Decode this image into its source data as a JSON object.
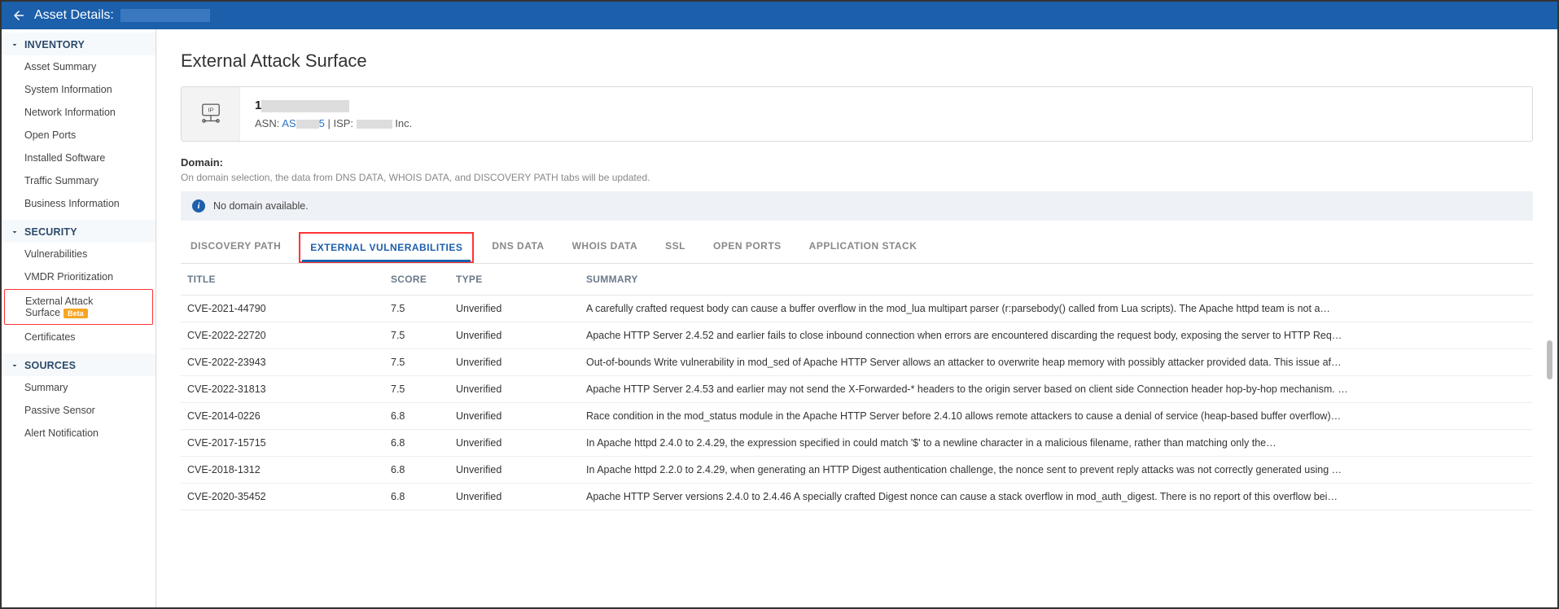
{
  "header": {
    "title_prefix": "Asset Details:"
  },
  "sidebar": {
    "sections": [
      {
        "label": "INVENTORY",
        "items": [
          {
            "label": "Asset Summary",
            "name": "asset-summary"
          },
          {
            "label": "System Information",
            "name": "system-information"
          },
          {
            "label": "Network Information",
            "name": "network-information"
          },
          {
            "label": "Open Ports",
            "name": "open-ports"
          },
          {
            "label": "Installed Software",
            "name": "installed-software"
          },
          {
            "label": "Traffic Summary",
            "name": "traffic-summary"
          },
          {
            "label": "Business Information",
            "name": "business-information"
          }
        ]
      },
      {
        "label": "SECURITY",
        "items": [
          {
            "label": "Vulnerabilities",
            "name": "vulnerabilities"
          },
          {
            "label": "VMDR Prioritization",
            "name": "vmdr-prioritization"
          },
          {
            "label": "External Attack Surface",
            "name": "external-attack-surface",
            "badge": "Beta",
            "active": true
          },
          {
            "label": "Certificates",
            "name": "certificates"
          }
        ]
      },
      {
        "label": "SOURCES",
        "items": [
          {
            "label": "Summary",
            "name": "sources-summary"
          },
          {
            "label": "Passive Sensor",
            "name": "passive-sensor"
          },
          {
            "label": "Alert Notification",
            "name": "alert-notification"
          }
        ]
      }
    ]
  },
  "main": {
    "page_title": "External Attack Surface",
    "info": {
      "ip_prefix": "1",
      "asn_label": "ASN:",
      "asn_prefix": "AS",
      "asn_suffix": "5",
      "isp_label": "ISP:",
      "isp_suffix": "Inc.",
      "sep": "  |  "
    },
    "domain": {
      "label": "Domain:",
      "desc": "On domain selection, the data from DNS DATA, WHOIS DATA, and DISCOVERY PATH tabs will be updated.",
      "alert": "No domain available."
    },
    "tabs": [
      {
        "label": "DISCOVERY PATH",
        "name": "tab-discovery-path"
      },
      {
        "label": "EXTERNAL VULNERABILITIES",
        "name": "tab-external-vulnerabilities",
        "active": true,
        "highlighted": true
      },
      {
        "label": "DNS DATA",
        "name": "tab-dns-data"
      },
      {
        "label": "WHOIS DATA",
        "name": "tab-whois-data"
      },
      {
        "label": "SSL",
        "name": "tab-ssl"
      },
      {
        "label": "OPEN PORTS",
        "name": "tab-open-ports"
      },
      {
        "label": "APPLICATION STACK",
        "name": "tab-application-stack"
      }
    ],
    "table": {
      "headers": {
        "title": "TITLE",
        "score": "SCORE",
        "type": "TYPE",
        "summary": "SUMMARY"
      },
      "rows": [
        {
          "title": "CVE-2021-44790",
          "score": "7.5",
          "type": "Unverified",
          "summary": "A carefully crafted request body can cause a buffer overflow in the mod_lua multipart parser (r:parsebody() called from Lua scripts). The Apache httpd team is not a…"
        },
        {
          "title": "CVE-2022-22720",
          "score": "7.5",
          "type": "Unverified",
          "summary": "Apache HTTP Server 2.4.52 and earlier fails to close inbound connection when errors are encountered discarding the request body, exposing the server to HTTP Req…"
        },
        {
          "title": "CVE-2022-23943",
          "score": "7.5",
          "type": "Unverified",
          "summary": "Out-of-bounds Write vulnerability in mod_sed of Apache HTTP Server allows an attacker to overwrite heap memory with possibly attacker provided data. This issue af…"
        },
        {
          "title": "CVE-2022-31813",
          "score": "7.5",
          "type": "Unverified",
          "summary": "Apache HTTP Server 2.4.53 and earlier may not send the X-Forwarded-* headers to the origin server based on client side Connection header hop-by-hop mechanism. …"
        },
        {
          "title": "CVE-2014-0226",
          "score": "6.8",
          "type": "Unverified",
          "summary": "Race condition in the mod_status module in the Apache HTTP Server before 2.4.10 allows remote attackers to cause a denial of service (heap-based buffer overflow)…"
        },
        {
          "title": "CVE-2017-15715",
          "score": "6.8",
          "type": "Unverified",
          "summary": "In Apache httpd 2.4.0 to 2.4.29, the expression specified in <FilesMatch> could match '$' to a newline character in a malicious filename, rather than matching only the…"
        },
        {
          "title": "CVE-2018-1312",
          "score": "6.8",
          "type": "Unverified",
          "summary": "In Apache httpd 2.2.0 to 2.4.29, when generating an HTTP Digest authentication challenge, the nonce sent to prevent reply attacks was not correctly generated using …"
        },
        {
          "title": "CVE-2020-35452",
          "score": "6.8",
          "type": "Unverified",
          "summary": "Apache HTTP Server versions 2.4.0 to 2.4.46 A specially crafted Digest nonce can cause a stack overflow in mod_auth_digest. There is no report of this overflow bei…"
        }
      ]
    }
  }
}
